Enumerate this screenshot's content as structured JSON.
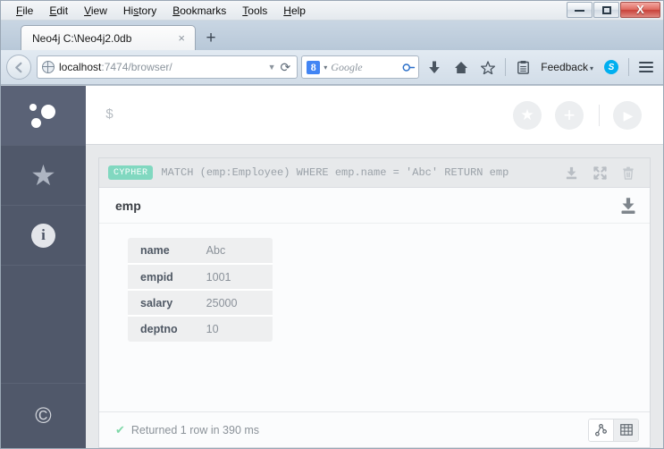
{
  "browser": {
    "menus": [
      {
        "accel": "F",
        "rest": "ile"
      },
      {
        "accel": "E",
        "rest": "dit"
      },
      {
        "accel": "V",
        "rest": "iew"
      },
      {
        "accel": "s",
        "rest": "History"
      },
      {
        "accel": "B",
        "rest": "ookmarks"
      },
      {
        "accel": "T",
        "rest": "ools"
      },
      {
        "accel": "H",
        "rest": "elp"
      }
    ],
    "menu_labels": [
      "File",
      "Edit",
      "View",
      "History",
      "Bookmarks",
      "Tools",
      "Help"
    ],
    "window_controls": {
      "minimize": "minimize",
      "maximize": "maximize",
      "close": "x"
    },
    "tab": {
      "title": "Neo4j C:\\Neo4j2.0db",
      "close_label": "×"
    },
    "new_tab_label": "+",
    "back_label": "←",
    "url": {
      "host": "localhost",
      "path": ":7474/browser/",
      "full": "localhost:7474/browser/",
      "dropdown_caret": "▼",
      "reload_label": "⟳"
    },
    "search": {
      "engine_logo": "8",
      "caret": "▾",
      "placeholder": "Google",
      "magnifier": "⌕"
    },
    "toolbar": {
      "download_label": "⬇",
      "home_label": "⌂",
      "bookmark_star_label": "☆",
      "reader_label": "▤",
      "feedback_label": "Feedback",
      "feedback_caret": "▾",
      "skype_label": "S"
    }
  },
  "app": {
    "sidebar": {
      "items": [
        {
          "name": "database",
          "label": "Database"
        },
        {
          "name": "favorites",
          "label": "Favorites",
          "glyph": "★"
        },
        {
          "name": "about",
          "label": "About",
          "glyph": "i"
        }
      ],
      "footer": {
        "name": "copyright",
        "glyph": "©"
      }
    },
    "editor": {
      "prompt": "$",
      "placeholder": "",
      "buttons": [
        {
          "name": "favorite",
          "glyph": "★"
        },
        {
          "name": "add",
          "glyph": "+"
        },
        {
          "name": "run",
          "glyph": "▶"
        }
      ]
    },
    "frame": {
      "badge": "CYPHER",
      "query": "MATCH (emp:Employee) WHERE emp.name = 'Abc' RETURN emp",
      "actions": [
        {
          "name": "download",
          "label": "Download"
        },
        {
          "name": "expand",
          "label": "Fullscreen"
        },
        {
          "name": "close",
          "label": "Close"
        }
      ],
      "result_title": "emp",
      "properties": [
        {
          "key": "name",
          "value": "Abc"
        },
        {
          "key": "empid",
          "value": "1001"
        },
        {
          "key": "salary",
          "value": "25000"
        },
        {
          "key": "deptno",
          "value": "10"
        }
      ],
      "status": {
        "check": "✔",
        "text": "Returned 1 row in 390 ms"
      },
      "view_toggle": [
        {
          "name": "graph-view",
          "label": "graph",
          "active": false
        },
        {
          "name": "table-view",
          "label": "table",
          "active": true
        }
      ]
    }
  },
  "colors": {
    "sidebar_bg": "#50586a",
    "cypher_badge": "#81d8c0",
    "status_check": "#7fd8a8",
    "stream_bg": "#e7e9eb",
    "skype_blue": "#00aff0",
    "google_blue": "#4285f4"
  }
}
